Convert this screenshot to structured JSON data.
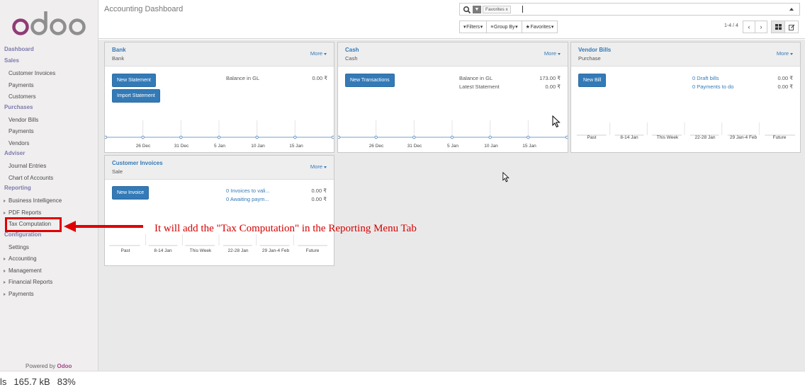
{
  "brand": {
    "logo_text": "odoo"
  },
  "sidebar": {
    "groups": [
      {
        "category": "Dashboard"
      },
      {
        "category": "Sales",
        "items": [
          "Customer Invoices",
          "Payments",
          "Customers"
        ]
      },
      {
        "category": "Purchases",
        "items": [
          "Vendor Bills",
          "Payments",
          "Vendors"
        ]
      },
      {
        "category": "Adviser",
        "items": [
          "Journal Entries",
          "Chart of Accounts"
        ]
      },
      {
        "category": "Reporting",
        "items": [
          "Business Intelligence",
          "PDF Reports",
          "Tax Computation"
        ]
      },
      {
        "category": "Configuration",
        "items": [
          "Settings",
          "Accounting",
          "Management",
          "Financial Reports",
          "Payments"
        ]
      }
    ],
    "powered_prefix": "Powered by",
    "powered_brand": "Odoo"
  },
  "control_panel": {
    "breadcrumb": "Accounting Dashboard",
    "facet_label": "Favorites",
    "facet_remove": "x",
    "filters_label": "Filters",
    "groupby_label": "Group By",
    "favorites_label": "Favorites",
    "pager": "1-4 / 4"
  },
  "cards": {
    "bank": {
      "title": "Bank",
      "subtitle": "Bank",
      "more": "More",
      "btn1": "New Statement",
      "btn2": "Import Statement",
      "balance_label": "Balance in GL",
      "balance_value": "0.00 ₹",
      "axis": [
        "26 Dec",
        "31 Dec",
        "5 Jan",
        "10 Jan",
        "15 Jan"
      ]
    },
    "cash": {
      "title": "Cash",
      "subtitle": "Cash",
      "more": "More",
      "btn1": "New Transactions",
      "balance_label": "Balance in GL",
      "balance_value": "173.00 ₹",
      "statement_label": "Latest Statement",
      "statement_value": "0.00 ₹",
      "axis": [
        "26 Dec",
        "31 Dec",
        "5 Jan",
        "10 Jan",
        "15 Jan"
      ]
    },
    "vendor": {
      "title": "Vendor Bills",
      "subtitle": "Purchase",
      "more": "More",
      "btn1": "New Bill",
      "link1": "0 Draft bills",
      "value1": "0.00 ₹",
      "link2": "0 Payments to do",
      "value2": "0.00 ₹",
      "axis": [
        "Past",
        "8-14 Jan",
        "This Week",
        "22-28 Jan",
        "29 Jan-4 Feb",
        "Future"
      ]
    },
    "customer": {
      "title": "Customer Invoices",
      "subtitle": "Sale",
      "more": "More",
      "btn1": "New Invoice",
      "link1": "0 Invoices to vali...",
      "value1": "0.00 ₹",
      "link2": "0 Awaiting paym...",
      "value2": "0.00 ₹",
      "axis": [
        "Past",
        "8-14 Jan",
        "This Week",
        "22-28 Jan",
        "29 Jan-4 Feb",
        "Future"
      ]
    }
  },
  "annotation": {
    "text": "It will add the \"Tax Computation\" in the Reporting Menu Tab",
    "color": "#d60000"
  },
  "statusbar": {
    "partial": "ls",
    "size": "165.7 kB",
    "zoom": "83%"
  },
  "colors": {
    "primary": "#337ab7",
    "brand": "#a24689",
    "category": "#7c7bad"
  }
}
